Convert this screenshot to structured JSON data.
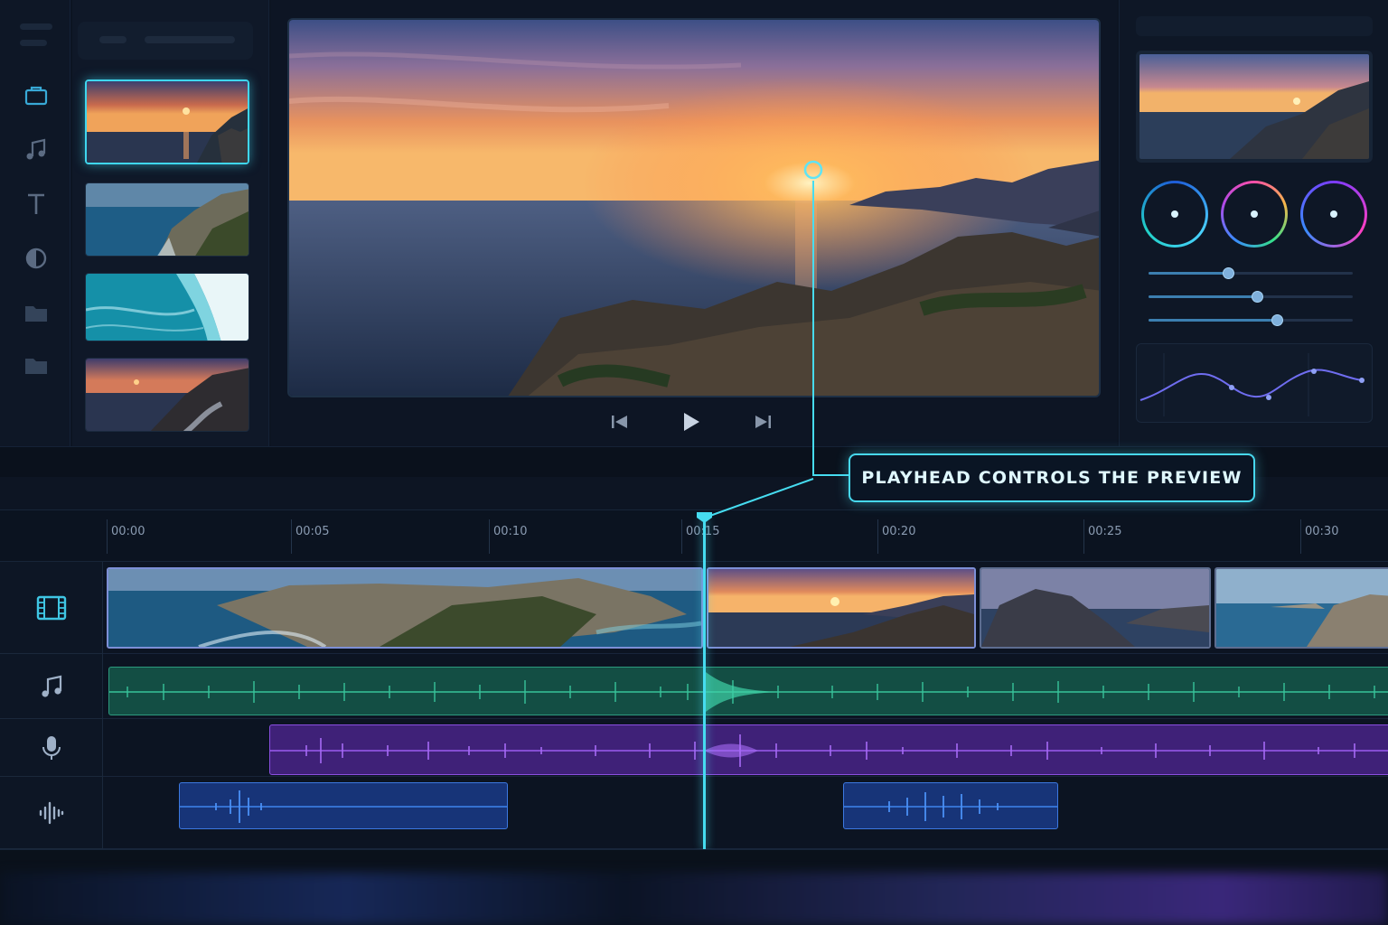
{
  "callout": {
    "text": "PLAYHEAD CONTROLS THE PREVIEW"
  },
  "ruler": {
    "ticks": [
      "00:00",
      "00:05",
      "00:10",
      "00:15",
      "00:20",
      "00:25",
      "00:30"
    ]
  },
  "playhead": {
    "time": "00:15"
  },
  "sidebar": {
    "items": [
      {
        "icon": "project-icon"
      },
      {
        "icon": "music-icon"
      },
      {
        "icon": "text-icon"
      },
      {
        "icon": "effects-icon"
      },
      {
        "icon": "folder-icon"
      },
      {
        "icon": "folder-icon"
      }
    ]
  },
  "media_bin": {
    "thumbnails": [
      {
        "scene": "sunset coast",
        "selected": true
      },
      {
        "scene": "cliffs sea",
        "selected": false
      },
      {
        "scene": "waves aerial",
        "selected": false
      },
      {
        "scene": "coastal road dusk",
        "selected": false
      }
    ]
  },
  "transport": {
    "buttons": [
      "skip-back-icon",
      "play-icon",
      "skip-forward-icon"
    ]
  },
  "inspector": {
    "sliders": [
      0.39,
      0.53,
      0.63
    ]
  },
  "tracks": [
    {
      "icon": "film-icon",
      "type": "video"
    },
    {
      "icon": "music-icon",
      "type": "music"
    },
    {
      "icon": "microphone-icon",
      "type": "voice"
    },
    {
      "icon": "audio-wave-icon",
      "type": "sfx"
    }
  ],
  "colors": {
    "accent": "#46dcf0",
    "music": "#2fae86",
    "voice": "#7a3fd1",
    "sfx": "#2f6fd6"
  }
}
